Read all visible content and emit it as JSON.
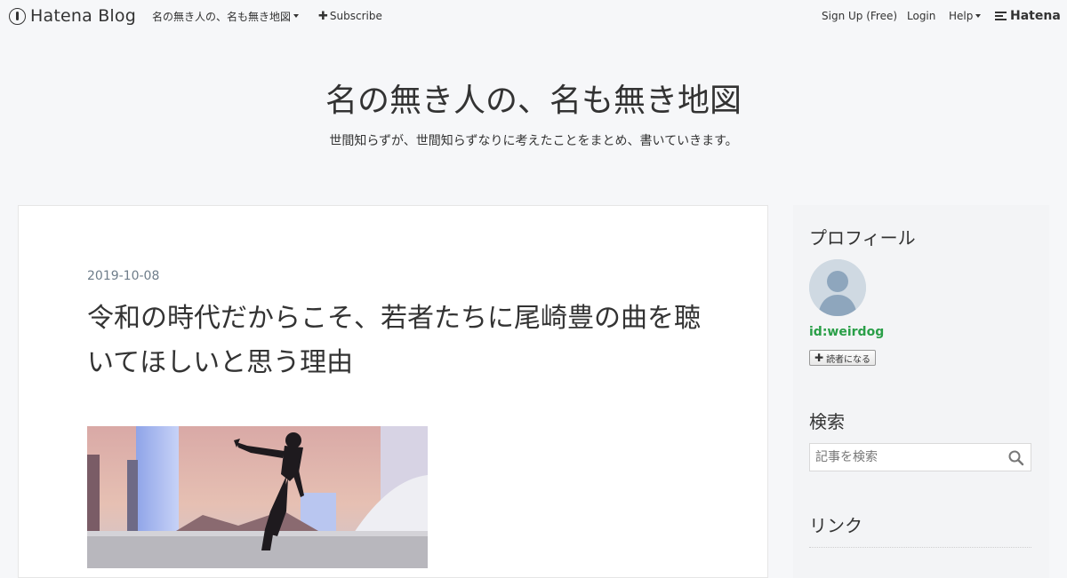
{
  "topbar": {
    "logo_text": "Hatena Blog",
    "blog_menu": "名の無き人の、名も無き地図",
    "subscribe": "Subscribe",
    "signup": "Sign Up (Free)",
    "login": "Login",
    "help": "Help",
    "hatena": "Hatena"
  },
  "header": {
    "title": "名の無き人の、名も無き地図",
    "description": "世間知らずが、世間知らずなりに考えたことをまとめ、書いていきます。"
  },
  "entry": {
    "date": "2019-10-08",
    "title": "令和の時代だからこそ、若者たちに尾崎豊の曲を聴いてほしいと思う理由"
  },
  "sidebar": {
    "profile_title": "プロフィール",
    "profile_id": "id:weirdog",
    "reader_button": "読者になる",
    "search_title": "検索",
    "search_placeholder": "記事を検索",
    "links_title": "リンク"
  },
  "colors": {
    "background": "#f6f7f9",
    "card": "#ffffff",
    "date": "#6e7d8a",
    "profile_id": "#2a9f48"
  }
}
